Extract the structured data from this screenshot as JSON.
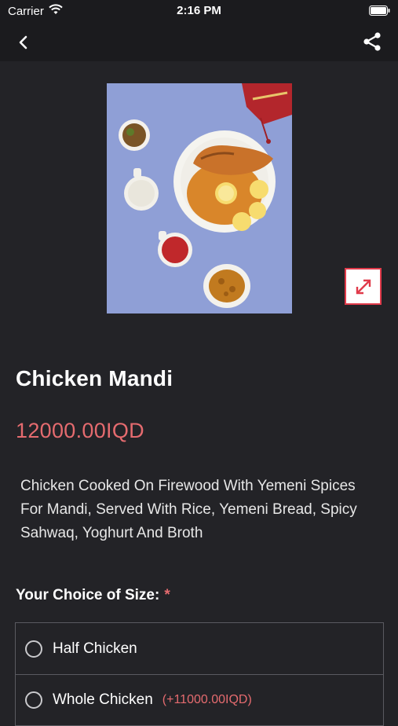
{
  "status": {
    "carrier": "Carrier",
    "time": "2:16 PM"
  },
  "product": {
    "name": "Chicken Mandi",
    "price": "12000.00IQD",
    "description": "Chicken Cooked On Firewood With Yemeni Spices For Mandi, Served With Rice, Yemeni Bread, Spicy Sahwaq, Yoghurt And Broth"
  },
  "size_section": {
    "label": "Your Choice of Size:",
    "required_mark": "*",
    "options": [
      {
        "label": "Half Chicken",
        "extra": ""
      },
      {
        "label": "Whole Chicken",
        "extra": "(+11000.00IQD)"
      }
    ]
  },
  "icons": {
    "back": "chevron-left-icon",
    "share": "share-icon",
    "expand": "expand-diagonal-icon",
    "wifi": "wifi-icon",
    "battery": "battery-icon"
  },
  "colors": {
    "accent": "#e56b6f",
    "background": "#232327",
    "image_bg": "#8f9fd6"
  }
}
